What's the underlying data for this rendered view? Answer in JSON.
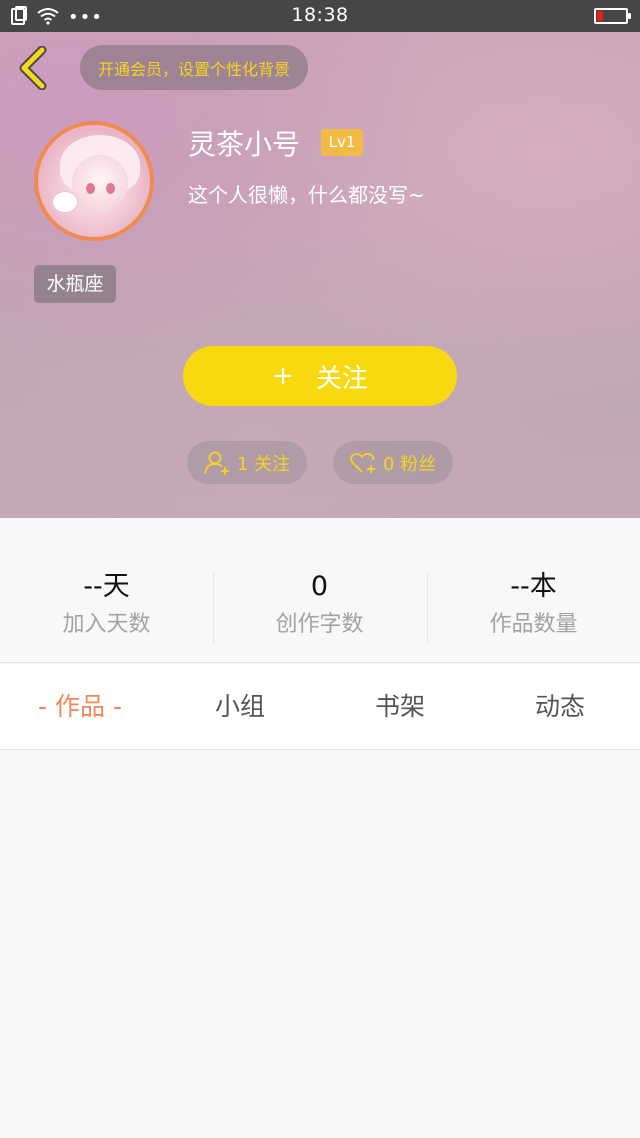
{
  "status_bar": {
    "time": "18:38",
    "dots": "•••"
  },
  "header": {
    "vip_banner": "开通会员，设置个性化背景",
    "username": "灵茶小号",
    "level": "Lv1",
    "bio": "这个人很懒，什么都没写~",
    "zodiac": "水瓶座",
    "follow_button": {
      "plus": "+",
      "label": "关注"
    },
    "following": "1 关注",
    "fans": "0 粉丝"
  },
  "stats": [
    {
      "value": "--天",
      "label": "加入天数"
    },
    {
      "value": "0",
      "label": "创作字数"
    },
    {
      "value": "--本",
      "label": "作品数量"
    }
  ],
  "tabs": [
    "- 作品 -",
    "小组",
    "书架",
    "动态"
  ],
  "colors": {
    "accent_yellow": "#f8d90f",
    "tab_active": "#f0895a",
    "level_badge": "#f1bb46",
    "avatar_border": "#f08a53"
  }
}
